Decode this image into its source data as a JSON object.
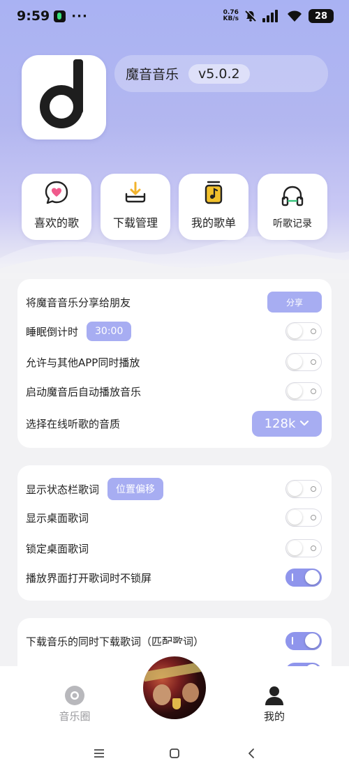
{
  "status_bar": {
    "time": "9:59",
    "dots": "···",
    "net_speed_value": "0.76",
    "net_speed_unit": "KB/s",
    "battery": "28"
  },
  "app": {
    "name": "魔音音乐",
    "version": "v5.0.2"
  },
  "quick_actions": [
    {
      "label": "喜欢的歌",
      "icon": "heart-chat-icon"
    },
    {
      "label": "下载管理",
      "icon": "download-tray-icon"
    },
    {
      "label": "我的歌单",
      "icon": "music-playlist-icon"
    },
    {
      "label": "听歌记录",
      "icon": "headphones-icon"
    }
  ],
  "settings_group1": {
    "share": {
      "label": "将魔音音乐分享给朋友",
      "button": "分享"
    },
    "sleep_timer": {
      "label": "睡眠倒计时",
      "value": "30:00",
      "enabled": false
    },
    "allow_other_apps": {
      "label": "允许与其他APP同时播放",
      "enabled": false
    },
    "autoplay": {
      "label": "启动魔音后自动播放音乐",
      "enabled": false
    },
    "quality": {
      "label": "选择在线听歌的音质",
      "value": "128k"
    }
  },
  "settings_group2": {
    "statusbar_lyrics": {
      "label": "显示状态栏歌词",
      "button": "位置偏移",
      "enabled": false
    },
    "desktop_lyrics": {
      "label": "显示桌面歌词",
      "enabled": false
    },
    "lock_desktop_lyrics": {
      "label": "锁定桌面歌词",
      "enabled": false
    },
    "no_lock_screen": {
      "label": "播放界面打开歌词时不锁屏",
      "enabled": true
    }
  },
  "settings_group3": {
    "download_lyrics": {
      "label": "下载音乐的同时下载歌词（匹配歌词）",
      "enabled": true
    }
  },
  "bottom_nav": {
    "left": {
      "label": "音乐圈",
      "icon": "disc-icon",
      "active": false
    },
    "right": {
      "label": "我的",
      "icon": "person-icon",
      "active": true
    }
  },
  "colors": {
    "accent": "#a7adf2",
    "toggle_on": "#8f95ec",
    "hero_top": "#a9b2f3"
  }
}
